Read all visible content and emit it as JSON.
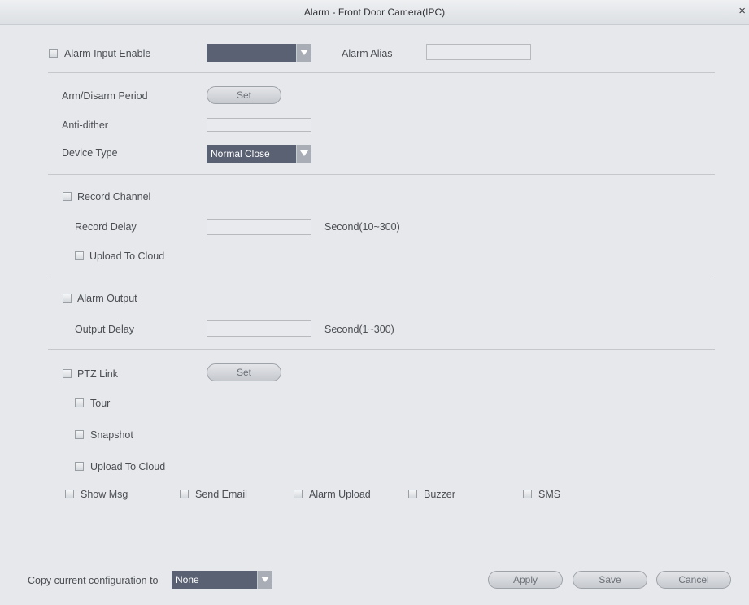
{
  "window": {
    "title": "Alarm - Front Door Camera(IPC)",
    "close_glyph": "×"
  },
  "alarm_input": {
    "label": "Alarm Input Enable",
    "selected": "",
    "alias_label": "Alarm Alias",
    "alias_value": ""
  },
  "arm_disarm": {
    "label": "Arm/Disarm Period",
    "button": "Set"
  },
  "anti_dither": {
    "label": "Anti-dither",
    "value": ""
  },
  "device_type": {
    "label": "Device Type",
    "selected": "Normal Close"
  },
  "record": {
    "channel_label": "Record Channel",
    "delay_label": "Record Delay",
    "delay_value": "",
    "delay_unit": "Second(10~300)",
    "upload_label": "Upload To Cloud"
  },
  "alarm_output": {
    "label": "Alarm Output",
    "delay_label": "Output Delay",
    "delay_value": "",
    "delay_unit": "Second(1~300)"
  },
  "ptz": {
    "label": "PTZ Link",
    "button": "Set",
    "tour_label": "Tour",
    "snapshot_label": "Snapshot",
    "upload_label": "Upload To Cloud"
  },
  "actions": {
    "show_msg": "Show Msg",
    "send_email": "Send Email",
    "alarm_upload": "Alarm Upload",
    "buzzer": "Buzzer",
    "sms": "SMS"
  },
  "footer": {
    "copy_label": "Copy current configuration to",
    "copy_selected": "None",
    "apply": "Apply",
    "save": "Save",
    "cancel": "Cancel"
  },
  "colors": {
    "select_bg": "#5a6173",
    "background": "#e6e8ec",
    "button_text": "#6d7178"
  }
}
